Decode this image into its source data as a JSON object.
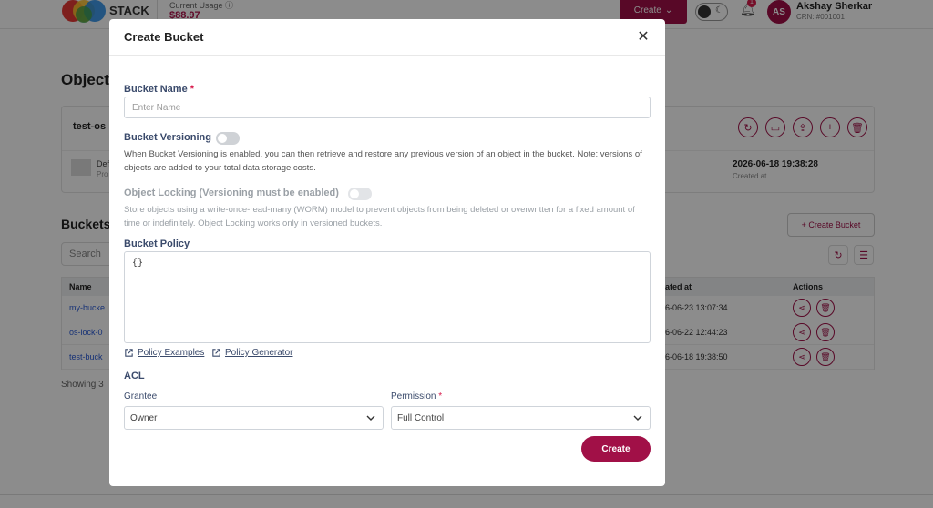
{
  "topbar": {
    "logo_text": "STACK",
    "usage_label": "Current Usage",
    "usage_value": "$88.97",
    "create_label": "Create",
    "notification_count": "1",
    "user_initials": "AS",
    "user_name": "Akshay Sherkar",
    "user_crn": "CRN: #001001"
  },
  "background": {
    "page_title": "Object",
    "detail_bucket_name": "test-os",
    "detail_item_name": "Def",
    "detail_item_sub": "Pro",
    "created_value": "2026-06-18 19:38:28",
    "created_label": "Created at",
    "buckets_title": "Buckets",
    "create_bucket_label": "+ Create Bucket",
    "search_placeholder": "Search",
    "table": {
      "headers": {
        "name": "Name",
        "created": "ated at",
        "actions": "Actions"
      },
      "rows": [
        {
          "name": "my-bucke",
          "created": "6-06-23 13:07:34"
        },
        {
          "name": "os-lock-0",
          "created": "6-06-22 12:44:23"
        },
        {
          "name": "test-buck",
          "created": "6-06-18 19:38:50"
        }
      ]
    },
    "showing_text": "Showing 3"
  },
  "modal": {
    "title": "Create Bucket",
    "bucket_name_label": "Bucket Name",
    "required_mark": "*",
    "bucket_name_placeholder": "Enter Name",
    "bucket_name_value": "",
    "versioning_label": "Bucket Versioning",
    "versioning_enabled": false,
    "versioning_help": "When Bucket Versioning is enabled, you can then retrieve and restore any previous version of an object in the bucket. Note: versions of objects are added to your total data storage costs.",
    "locking_label": "Object Locking (Versioning must be enabled)",
    "locking_enabled": false,
    "locking_help": "Store objects using a write-once-read-many (WORM) model to prevent objects from being deleted or overwritten for a fixed amount of time or indefinitely. Object Locking works only in versioned buckets.",
    "policy_label": "Bucket Policy",
    "policy_value": "{}",
    "policy_examples_link": "Policy Examples",
    "policy_generator_link": "Policy Generator",
    "acl_label": "ACL",
    "grantee_label": "Grantee",
    "grantee_value": "Owner",
    "permission_label": "Permission",
    "permission_value": "Full Control",
    "submit_label": "Create"
  },
  "colors": {
    "brand": "#a11047",
    "label": "#3a4a6b",
    "required": "#d81b4c"
  }
}
